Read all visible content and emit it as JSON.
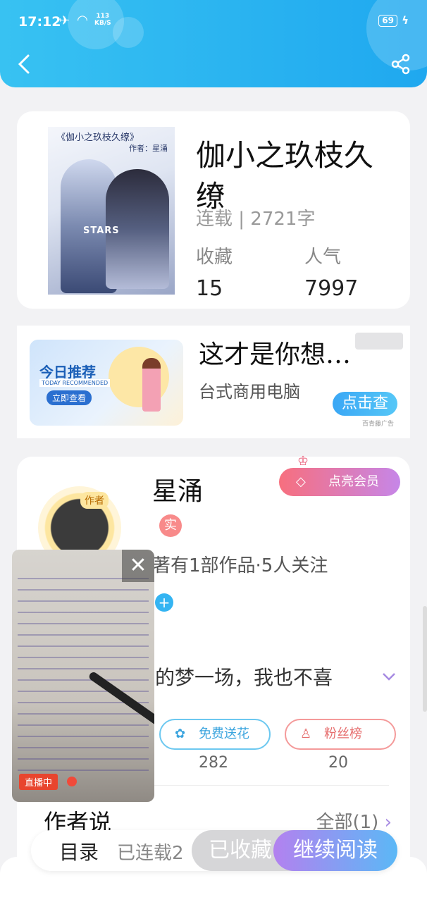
{
  "status_bar": {
    "time": "17:12",
    "speed_value": "113",
    "speed_unit": "KB/S",
    "battery": "69"
  },
  "header": {
    "back_icon": "chevron-left-icon",
    "share_icon": "share-icon"
  },
  "book": {
    "cover_title": "《伽小之玖枝久缭》",
    "cover_author": "作者：星涌",
    "cover_text": "STARS",
    "title": "伽小之玖枝久缭",
    "serial_info": "连载 | 2721字",
    "favorites_label": "收藏",
    "favorites_value": "15",
    "popularity_label": "人气",
    "popularity_value": "7997"
  },
  "ad": {
    "image_title": "今日推荐",
    "image_subtitle": "TODAY RECOMMENDED",
    "image_button": "立即查看",
    "title": "这才是你想…",
    "subtitle": "台式商用电脑",
    "cta": "点击查",
    "note": "百青藤广告"
  },
  "author": {
    "tag": "作者",
    "name": "星涌",
    "vip_button": "点亮会员",
    "real_badge": "实",
    "works": "著有1部作品·5人关注",
    "follow": "+",
    "intro": "的梦一场，我也不喜",
    "flower_button": "免费送花",
    "flower_count": "282",
    "fans_button": "粉丝榜",
    "fans_count": "20",
    "say_title": "作者说",
    "say_all": "全部(1)"
  },
  "video": {
    "live_label": "直播中",
    "close": "✕"
  },
  "bottom_bar": {
    "toc": "目录",
    "serialized": "已连载2",
    "collected": "已收藏",
    "continue": "继续阅读"
  },
  "colors": {
    "header": "#1fa8ef",
    "accent_pink": "#f76f7e",
    "accent_purple": "#b381ef"
  }
}
